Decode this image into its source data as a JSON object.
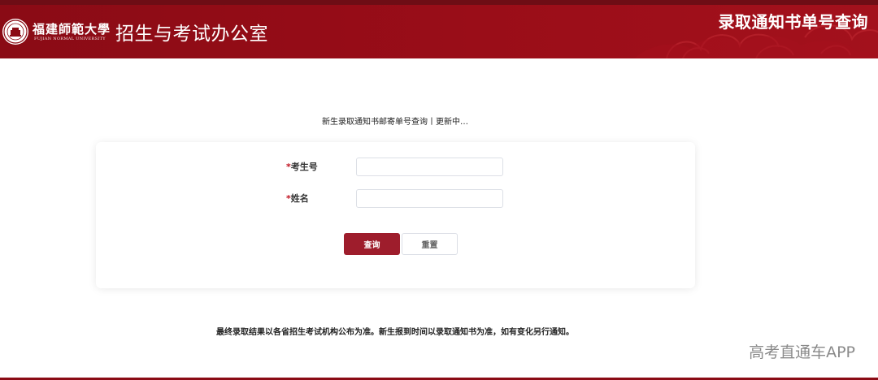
{
  "header": {
    "school_name_cn": "福建師範大學",
    "school_name_en": "FUJIAN NORMAL UNIVERSITY",
    "office_title": "招生与考试办公室",
    "page_heading": "录取通知书单号查询",
    "logo_icon": "university-seal-icon",
    "colors": {
      "primary": "#8a0b15",
      "button": "#9e1d2c",
      "required": "#c0111f"
    }
  },
  "notice": "新生录取通知书邮寄单号查询丨更新中…",
  "form": {
    "fields": [
      {
        "required_mark": "*",
        "label": "考生号",
        "value": ""
      },
      {
        "required_mark": "*",
        "label": "姓名",
        "value": ""
      }
    ],
    "query_button": "查询",
    "reset_button": "重置"
  },
  "footer_note": "最终录取结果以各省招生考试机构公布为准。新生报到时间以录取通知书为准，如有变化另行通知。",
  "watermark": "高考直通车APP"
}
